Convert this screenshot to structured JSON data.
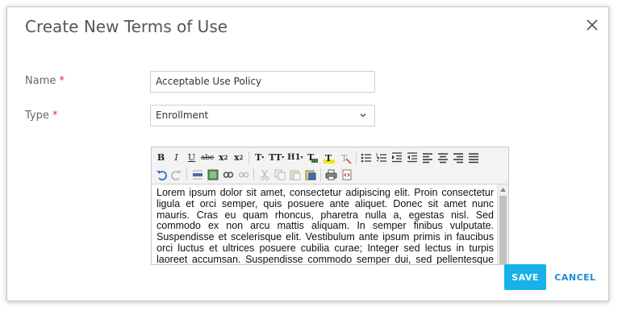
{
  "dialog": {
    "title": "Create New Terms of Use",
    "close_icon": "close-icon"
  },
  "form": {
    "name_label": "Name",
    "name_required": "*",
    "name_value": "Acceptable Use Policy",
    "type_label": "Type",
    "type_required": "*",
    "type_value": "Enrollment"
  },
  "editor": {
    "toolbar_row1": [
      "bold-icon",
      "italic-icon",
      "underline-icon",
      "strikethrough-icon",
      "subscript-icon",
      "superscript-icon",
      "font-size-icon",
      "text-size-icon",
      "heading-icon",
      "font-color-icon",
      "highlight-icon",
      "clear-format-icon",
      "bullet-list-icon",
      "numbered-list-icon",
      "indent-icon",
      "outdent-icon",
      "align-left-icon",
      "align-center-icon",
      "align-right-icon",
      "justify-icon"
    ],
    "toolbar_row2": [
      "undo-icon",
      "redo-icon",
      "horizontal-rule-icon",
      "image-icon",
      "link-icon",
      "unlink-icon",
      "cut-icon",
      "copy-icon",
      "paste-icon",
      "paste-word-icon",
      "print-icon",
      "source-code-icon"
    ],
    "content": "Lorem ipsum dolor sit amet, consectetur adipiscing elit. Proin consectetur ligula et orci semper, quis posuere ante aliquet. Donec sit amet nunc mauris. Cras eu quam rhoncus, pharetra nulla a, egestas nisl. Sed commodo ex non arcu mattis aliquam. In semper finibus vulputate. Suspendisse et scelerisque elit. Vestibulum ante ipsum primis in faucibus orci luctus et ultrices posuere cubilia curae; Integer sed lectus in turpis laoreet accumsan. Suspendisse commodo semper dui, sed pellentesque ipsum ultricies quis. Vestibulum"
  },
  "buttons": {
    "save": "SAVE",
    "cancel": "CANCEL"
  },
  "colors": {
    "accent": "#1ab0ea",
    "link": "#1a8fd0",
    "required": "#e0312f"
  }
}
